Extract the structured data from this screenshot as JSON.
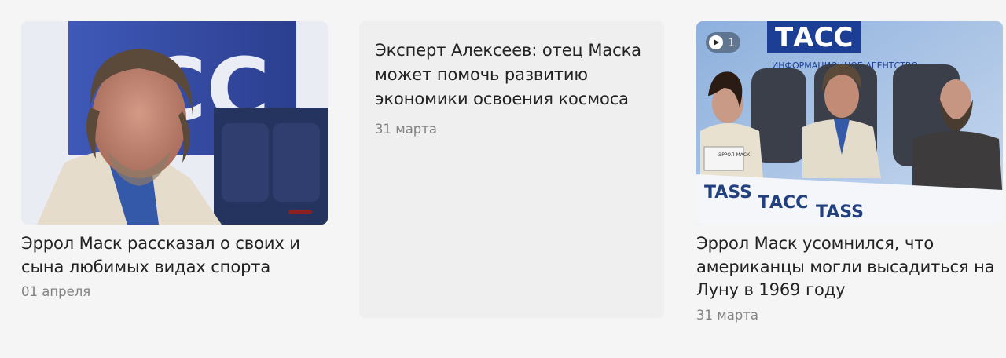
{
  "news": [
    {
      "title": "Эррол Маск рассказал о своих и сына любимых видах спорта",
      "date": "01 апреля",
      "image_icon": "photo-thumbnail"
    },
    {
      "title": "Эксперт Алексеев: отец Маска может помочь развитию экономики освоения космоса",
      "date": "31 марта"
    },
    {
      "title": "Эррол Маск усомнился, что американцы могли высадиться на Луну в 1969 году",
      "date": "31 марта",
      "media_count": "1",
      "image_icon": "photo-thumbnail",
      "badge_icon": "play-icon"
    }
  ],
  "image_text": {
    "tass_logo": "ТАСС",
    "tass_subtitle": "ИНФОРМАЦИОННОЕ АГЕНТСТВО",
    "tass_table_1": "TASS",
    "tass_table_2": "ТАСС",
    "tass_table_3": "TASS",
    "nameplate": "ЭРРОЛ МАСК"
  },
  "colors": {
    "background": "#f5f5f5",
    "card": "#efefef",
    "title": "#222222",
    "date": "#828282"
  }
}
